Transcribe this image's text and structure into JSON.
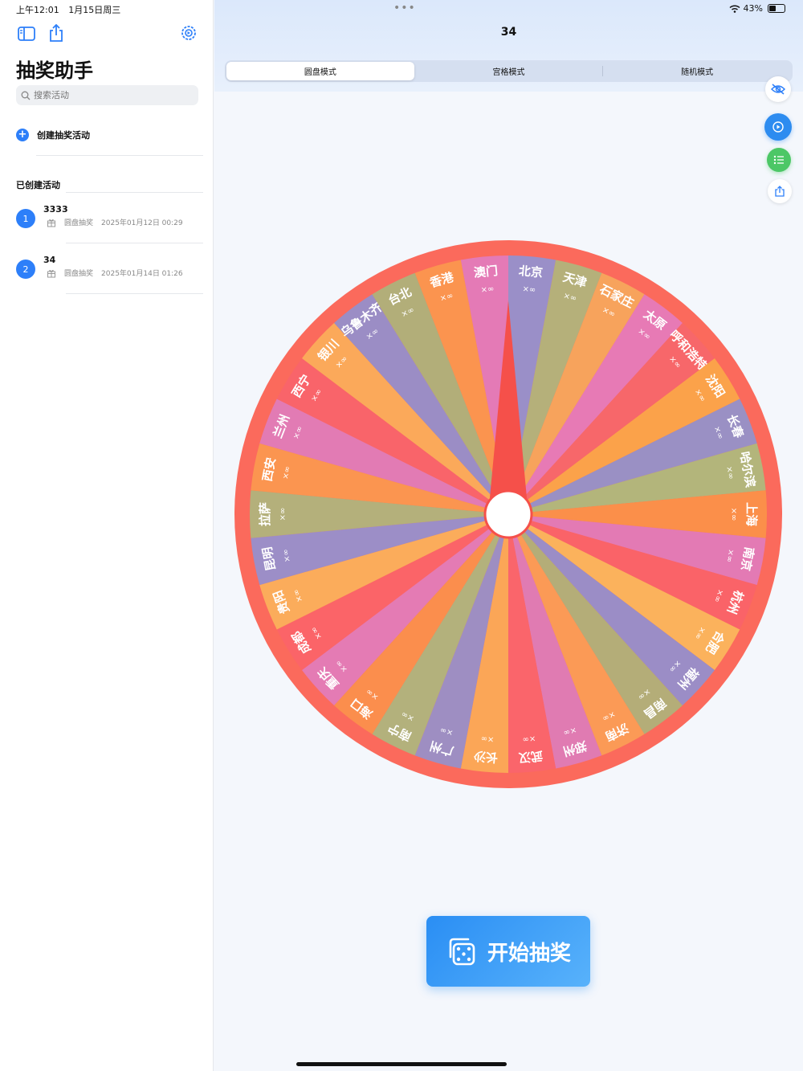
{
  "status": {
    "time": "上午12:01",
    "date": "1月15日周三",
    "battery": "43%"
  },
  "sidebar": {
    "title": "抽奖助手",
    "search_placeholder": "搜索活动",
    "create_label": "创建抽奖活动",
    "section_label": "已创建活动",
    "activities": [
      {
        "num": "1",
        "name": "3333",
        "type": "圆盘抽奖",
        "date": "2025年01月12日 00:29"
      },
      {
        "num": "2",
        "name": "34",
        "type": "圆盘抽奖",
        "date": "2025年01月14日 01:26"
      }
    ]
  },
  "main": {
    "title": "34",
    "tabs": [
      {
        "label": "圆盘模式",
        "active": true
      },
      {
        "label": "宫格模式",
        "active": false
      },
      {
        "label": "随机模式",
        "active": false
      }
    ],
    "start_label": "开始抽奖"
  },
  "wheel": {
    "count_label": "×∞",
    "segments": [
      "北京",
      "天津",
      "石家庄",
      "太原",
      "呼和浩特",
      "沈阳",
      "长春",
      "哈尔滨",
      "上海",
      "南京",
      "杭州",
      "合肥",
      "福州",
      "南昌",
      "济南",
      "郑州",
      "武汉",
      "长沙",
      "广州",
      "南宁",
      "海口",
      "重庆",
      "成都",
      "贵阳",
      "昆明",
      "拉萨",
      "西安",
      "兰州",
      "西宁",
      "银川",
      "乌鲁木齐",
      "台北",
      "香港",
      "澳门"
    ],
    "colors": [
      "#9a8fc8",
      "#b5b07a",
      "#f7a35c",
      "#e77ab5",
      "#f7676a",
      "#fba24a",
      "#9a90c4",
      "#b3b57b",
      "#fb8f4a",
      "#e37ab4",
      "#fa6368",
      "#fbb25c",
      "#9b8dc6",
      "#b4ad78",
      "#fb9a56",
      "#e07bb2",
      "#fa656b",
      "#fba657",
      "#9e8ec2",
      "#b3b17c",
      "#fb8e4d",
      "#e47bb4",
      "#fb6468",
      "#fbac5b",
      "#9c8ec7",
      "#b4b07b",
      "#fb9550",
      "#e27bb4",
      "#f9646a",
      "#fba95a",
      "#9b8dc5",
      "#b2ae79",
      "#fb944f",
      "#e47ab6"
    ],
    "rim_color": "#fb6a5c",
    "pointer_color": "#f5504a"
  }
}
